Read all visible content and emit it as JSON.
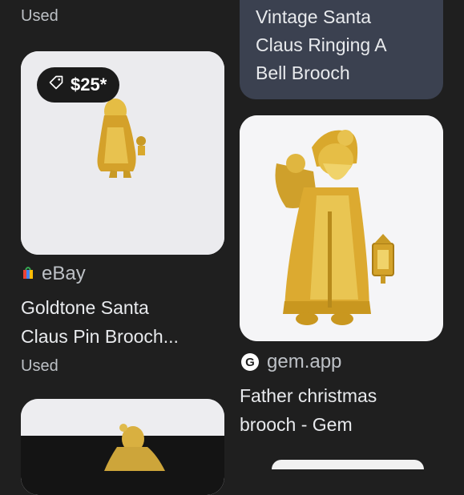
{
  "left": {
    "top_condition": "Used",
    "card1": {
      "price": "$25*",
      "source": "eBay",
      "title_line1": "Goldtone Santa",
      "title_line2": "Claus Pin Brooch...",
      "condition": "Used"
    }
  },
  "right": {
    "card0": {
      "title_line1": "Vintage Santa",
      "title_line2": "Claus Ringing A",
      "title_line3": "Bell Brooch"
    },
    "card1": {
      "source": "gem.app",
      "source_logo": "G",
      "title_line1": "Father christmas",
      "title_line2": "brooch - Gem"
    }
  },
  "colors": {
    "background": "#1f1f1f",
    "title_card": "#3b4150",
    "image_bg": "#f2f2f4"
  }
}
